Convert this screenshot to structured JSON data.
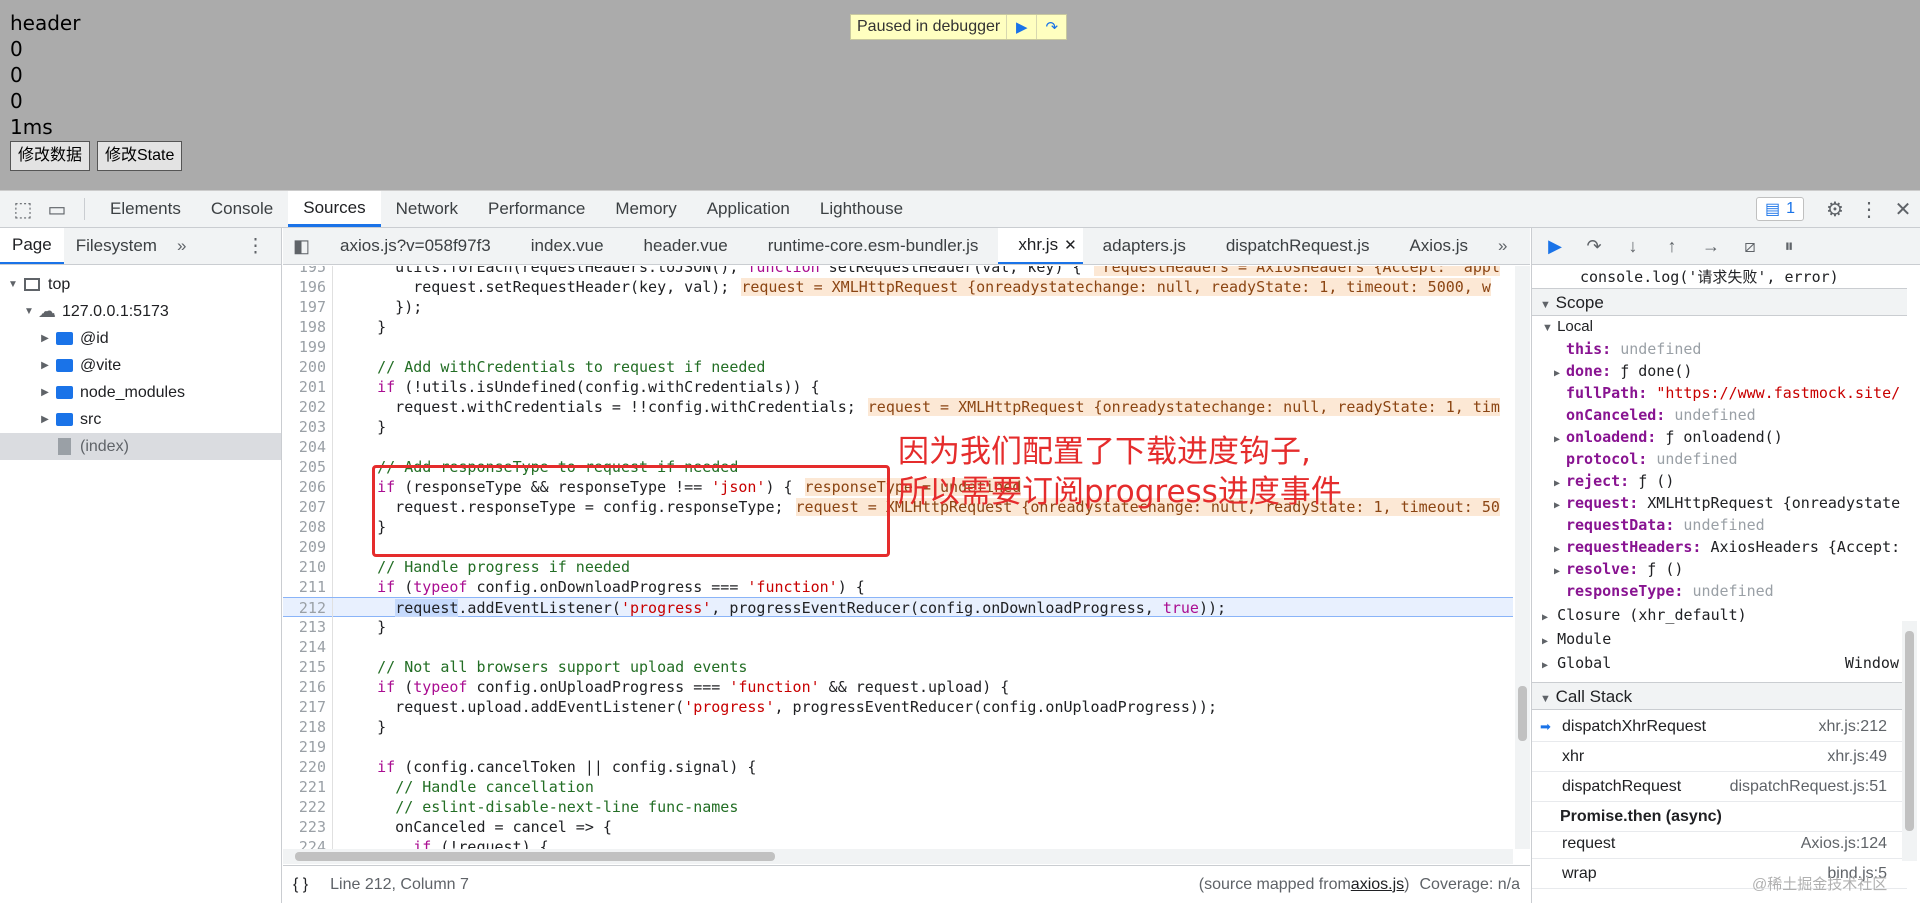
{
  "viewport": {
    "lines": [
      "header",
      "0",
      "0",
      "0",
      "1ms"
    ],
    "buttons": [
      "修改数据",
      "修改State"
    ],
    "paused_label": "Paused in debugger"
  },
  "devtools": {
    "tabs": [
      "Elements",
      "Console",
      "Sources",
      "Network",
      "Performance",
      "Memory",
      "Application",
      "Lighthouse"
    ],
    "active_tab": "Sources",
    "issues_count": "1"
  },
  "navigator": {
    "tabs": [
      "Page",
      "Filesystem"
    ],
    "tree": [
      {
        "label": "top",
        "kind": "frame"
      },
      {
        "label": "127.0.0.1:5173",
        "kind": "cloud"
      },
      {
        "label": "@id",
        "kind": "folder"
      },
      {
        "label": "@vite",
        "kind": "folder"
      },
      {
        "label": "node_modules",
        "kind": "folder"
      },
      {
        "label": "src",
        "kind": "folder"
      },
      {
        "label": "(index)",
        "kind": "file"
      }
    ]
  },
  "editor": {
    "file_tabs": [
      "axios.js?v=058f97f3",
      "index.vue",
      "header.vue",
      "runtime-core.esm-bundler.js",
      "xhr.js",
      "adapters.js",
      "dispatchRequest.js",
      "Axios.js"
    ],
    "active_file": "xhr.js",
    "lines": [
      {
        "n": "195",
        "html": "      utils.forEach(requestHeaders.toJSON(), <span class=\"kw\">function</span> setRequestHeader(val, key) {<span class=\"inl\"> requestHeaders = AxiosHeaders {Accept: 'appl</span>"
      },
      {
        "n": "196",
        "html": "        request.setRequestHeader(key, val);<span class=\"inl\">request = XMLHttpRequest {onreadystatechange: null, readyState: 1, timeout: 5000, w</span>"
      },
      {
        "n": "197",
        "html": "      });"
      },
      {
        "n": "198",
        "html": "    }"
      },
      {
        "n": "199",
        "html": ""
      },
      {
        "n": "200",
        "html": "    <span class=\"cm\">// Add withCredentials to request if needed</span>"
      },
      {
        "n": "201",
        "html": "    <span class=\"kw\">if</span> (!utils.isUndefined(config.withCredentials)) {"
      },
      {
        "n": "202",
        "html": "      request.withCredentials = !!config.withCredentials;<span class=\"inl\">request = XMLHttpRequest {onreadystatechange: null, readyState: 1, tim</span>"
      },
      {
        "n": "203",
        "html": "    }"
      },
      {
        "n": "204",
        "html": ""
      },
      {
        "n": "205",
        "html": "    <span class=\"cm\">// Add responseType to request if needed</span>"
      },
      {
        "n": "206",
        "html": "    <span class=\"kw\">if</span> (responseType &amp;&amp; responseType !== <span class=\"str\">'json'</span>) {<span class=\"inl\">responseType = undefined</span>"
      },
      {
        "n": "207",
        "html": "      request.responseType = config.responseType;<span class=\"inl\">request = XMLHttpRequest {onreadystatechange: null, readyState: 1, timeout: 50</span>"
      },
      {
        "n": "208",
        "html": "    }"
      },
      {
        "n": "209",
        "html": ""
      },
      {
        "n": "210",
        "html": "    <span class=\"cm\">// Handle progress if needed</span>"
      },
      {
        "n": "211",
        "html": "    <span class=\"kw\">if</span> (<span class=\"kw\">typeof</span> config.onDownloadProgress === <span class=\"str\">'function'</span>) {"
      },
      {
        "n": "212",
        "html": "      <span class=\"hl\">request</span>.addEventListener(<span class=\"str\">'progress'</span>, progressEventReducer(config.onDownloadProgress, <span class=\"kw\">true</span>));",
        "current": true
      },
      {
        "n": "213",
        "html": "    }"
      },
      {
        "n": "214",
        "html": ""
      },
      {
        "n": "215",
        "html": "    <span class=\"cm\">// Not all browsers support upload events</span>"
      },
      {
        "n": "216",
        "html": "    <span class=\"kw\">if</span> (<span class=\"kw\">typeof</span> config.onUploadProgress === <span class=\"str\">'function'</span> &amp;&amp; request.upload) {"
      },
      {
        "n": "217",
        "html": "      request.upload.addEventListener(<span class=\"str\">'progress'</span>, progressEventReducer(config.onUploadProgress));"
      },
      {
        "n": "218",
        "html": "    }"
      },
      {
        "n": "219",
        "html": ""
      },
      {
        "n": "220",
        "html": "    <span class=\"kw\">if</span> (config.cancelToken || config.signal) {"
      },
      {
        "n": "221",
        "html": "      <span class=\"cm\">// Handle cancellation</span>"
      },
      {
        "n": "222",
        "html": "      <span class=\"cm\">// eslint-disable-next-line func-names</span>"
      },
      {
        "n": "223",
        "html": "      onCanceled = cancel =&gt; {"
      },
      {
        "n": "224",
        "html": "        <span class=\"kw\">if</span> (!request) {"
      }
    ],
    "annotation_line1": "因为我们配置了下载进度钩子,",
    "annotation_line2": "所以需要订阅progress进度事件",
    "status_pos": "Line 212, Column 7",
    "status_map_prefix": "(source mapped from ",
    "status_map_file": "axios.js",
    "status_map_suffix": ")",
    "status_coverage": "Coverage: n/a"
  },
  "debugger": {
    "top_line": "console.log('请求失败', error)",
    "scope_title": "Scope",
    "local_title": "Local",
    "scope": [
      {
        "k": "this",
        "v": "undefined",
        "exp": false
      },
      {
        "k": "done",
        "v": "ƒ done()",
        "exp": true
      },
      {
        "k": "fullPath",
        "v": "\"https://www.fastmock.site/",
        "exp": false
      },
      {
        "k": "onCanceled",
        "v": "undefined",
        "exp": false
      },
      {
        "k": "onloadend",
        "v": "ƒ onloadend()",
        "exp": true
      },
      {
        "k": "protocol",
        "v": "undefined",
        "exp": false
      },
      {
        "k": "reject",
        "v": "ƒ ()",
        "exp": true
      },
      {
        "k": "request",
        "v": "XMLHttpRequest {onreadystate",
        "exp": true
      },
      {
        "k": "requestData",
        "v": "undefined",
        "exp": false
      },
      {
        "k": "requestHeaders",
        "v": "AxiosHeaders {Accept:",
        "exp": true
      },
      {
        "k": "resolve",
        "v": "ƒ ()",
        "exp": true
      },
      {
        "k": "responseType",
        "v": "undefined",
        "exp": false
      }
    ],
    "closure": "Closure (xhr_default)",
    "module": "Module",
    "global": "Global",
    "global_val": "Window",
    "callstack_title": "Call Stack",
    "callstack": [
      {
        "fn": "dispatchXhrRequest",
        "loc": "xhr.js:212",
        "current": true
      },
      {
        "fn": "xhr",
        "loc": "xhr.js:49"
      },
      {
        "fn": "dispatchRequest",
        "loc": "dispatchRequest.js:51"
      },
      {
        "fn": "Promise.then (async)",
        "loc": "",
        "async": true
      },
      {
        "fn": "request",
        "loc": "Axios.js:124"
      },
      {
        "fn": "wrap",
        "loc": "bind.js:5"
      }
    ]
  },
  "watermark": "@稀土掘金技术社区"
}
